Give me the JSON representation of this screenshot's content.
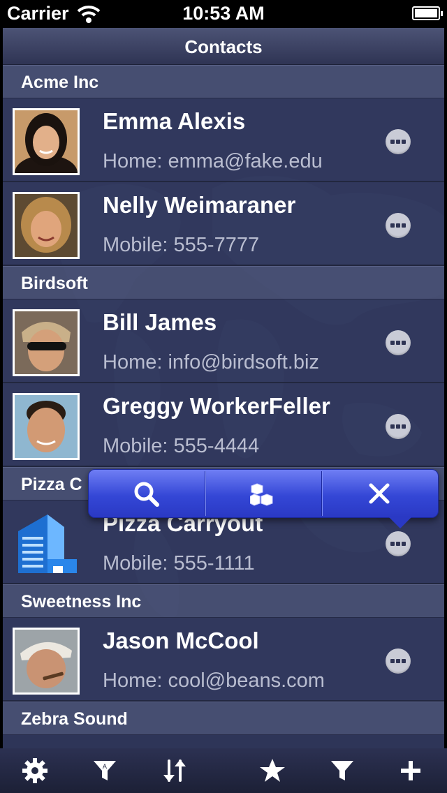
{
  "status_bar": {
    "carrier": "Carrier",
    "time": "10:53 AM"
  },
  "nav": {
    "title": "Contacts"
  },
  "sections": [
    {
      "title": "Acme Inc",
      "contacts": [
        {
          "name": "Emma Alexis",
          "detail": "Home: emma@fake.edu",
          "avatar": "photo-woman"
        },
        {
          "name": "Nelly Weimaraner",
          "detail": "Mobile: 555-7777",
          "avatar": "photo-woman-blonde"
        }
      ]
    },
    {
      "title": "Birdsoft",
      "contacts": [
        {
          "name": "Bill James",
          "detail": "Home: info@birdsoft.biz",
          "avatar": "photo-man-sunglasses"
        },
        {
          "name": "Greggy WorkerFeller",
          "detail": "Mobile: 555-4444",
          "avatar": "photo-man"
        }
      ]
    },
    {
      "title": "Pizza C",
      "contacts": [
        {
          "name": "Pizza Carryout",
          "detail": "Mobile: 555-1111",
          "avatar": "building-icon"
        }
      ]
    },
    {
      "title": "Sweetness Inc",
      "contacts": [
        {
          "name": "Jason McCool",
          "detail": "Home: cool@beans.com",
          "avatar": "photo-man-cigar"
        }
      ]
    },
    {
      "title": "Zebra Sound",
      "contacts": []
    }
  ],
  "popover": {
    "actions": [
      "search-icon",
      "cubes-icon",
      "close-icon"
    ]
  },
  "toolbar": {
    "buttons": [
      "gear-icon",
      "alpha-filter-icon",
      "sort-icon",
      "star-icon",
      "filter-icon",
      "add-icon"
    ]
  },
  "colors": {
    "background": "#2e3558",
    "popover": "#3447d6",
    "section": "#4a5276"
  }
}
